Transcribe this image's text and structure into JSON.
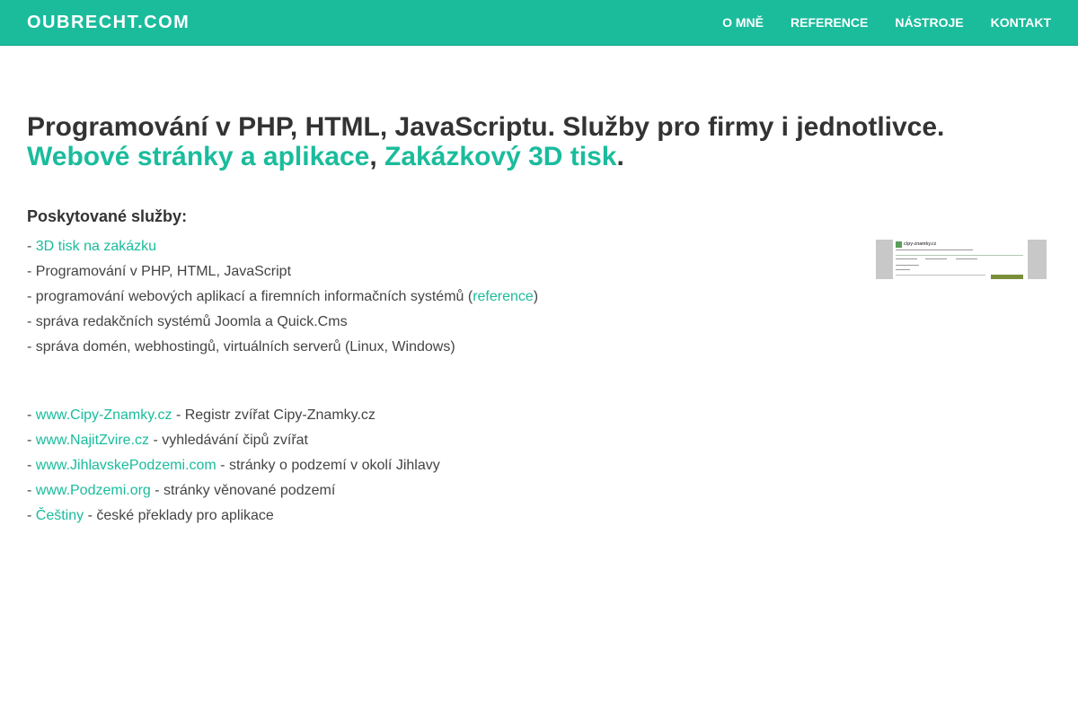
{
  "header": {
    "brand": "OUBRECHT.COM",
    "nav": [
      "O MNĚ",
      "REFERENCE",
      "NÁSTROJE",
      "KONTAKT"
    ]
  },
  "headline": {
    "line1": "Programování v PHP, HTML, JavaScriptu. Služby pro firmy i jednotlivce.",
    "link1": "Webové stránky a aplikace",
    "sep": ",",
    "link2": "Zakázkový 3D tisk",
    "end": "."
  },
  "services": {
    "heading": "Poskytované služby:",
    "item1_prefix": "- ",
    "item1_link": "3D tisk na zakázku",
    "item2": "- Programování v PHP, HTML, JavaScript",
    "item3_text": "- programování webových aplikací a firemních informačních systémů (",
    "item3_link": "reference",
    "item3_end": ")",
    "item4": "- správa redakčních systémů Joomla a Quick.Cms",
    "item5": "- správa domén, webhostingů, virtuálních serverů (Linux, Windows)"
  },
  "projects": [
    {
      "prefix": "- ",
      "link": "www.Cipy-Znamky.cz",
      "desc": " - Registr zvířat Cipy-Znamky.cz"
    },
    {
      "prefix": "- ",
      "link": "www.NajitZvire.cz",
      "desc": " - vyhledávání čipů zvířat"
    },
    {
      "prefix": "- ",
      "link": "www.JihlavskePodzemi.com",
      "desc": " - stránky o podzemí v okolí Jihlavy"
    },
    {
      "prefix": "- ",
      "link": "www.Podzemi.org",
      "desc": " - stránky věnované podzemí"
    },
    {
      "prefix": "- ",
      "link": "Češtiny",
      "desc": " - české překlady pro aplikace"
    }
  ],
  "thumbnail": {
    "logo_text": "cipy-znamky.cz"
  },
  "colors": {
    "accent": "#1abc9c",
    "text": "#444444",
    "heading": "#333333"
  }
}
